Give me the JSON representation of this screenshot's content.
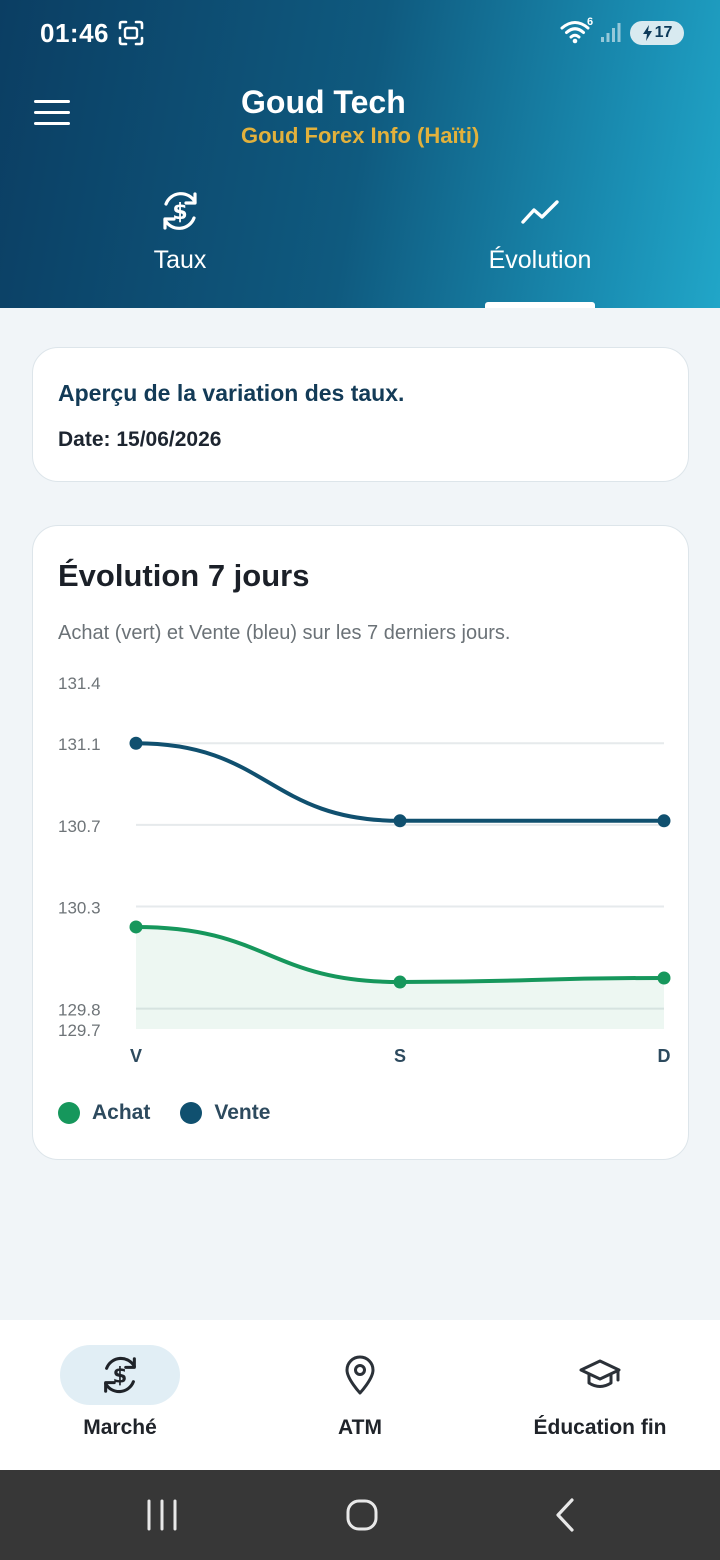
{
  "status_bar": {
    "time": "01:46",
    "wifi_label": "6",
    "battery": "17"
  },
  "header": {
    "title": "Goud Tech",
    "subtitle": "Goud Forex Info (Haïti)"
  },
  "tabs": [
    {
      "label": "Taux",
      "icon": "currency-exchange-icon",
      "active": false
    },
    {
      "label": "Évolution",
      "icon": "trending-icon",
      "active": true
    }
  ],
  "info_card": {
    "title": "Aperçu de la variation des taux.",
    "date": "Date: 15/06/2026"
  },
  "chart_card": {
    "title": "Évolution 7 jours",
    "subtitle": "Achat (vert) et Vente (bleu) sur les 7 derniers jours."
  },
  "chart_data": {
    "type": "line",
    "categories": [
      "V",
      "S",
      "D"
    ],
    "series": [
      {
        "name": "Achat",
        "color": "#16975c",
        "values": [
          130.2,
          129.93,
          129.95
        ]
      },
      {
        "name": "Vente",
        "color": "#10506f",
        "values": [
          131.1,
          130.72,
          130.72
        ]
      }
    ],
    "y_ticks": [
      "131.4",
      "131.1",
      "130.7",
      "130.3",
      "129.8",
      "129.7"
    ],
    "ylim": [
      129.7,
      131.4
    ],
    "grid": true,
    "legend_position": "bottom-left"
  },
  "legend": [
    {
      "label": "Achat",
      "color": "#16975c"
    },
    {
      "label": "Vente",
      "color": "#10506f"
    }
  ],
  "bottom_nav": [
    {
      "label": "Marché",
      "icon": "currency-exchange-icon",
      "active": true
    },
    {
      "label": "ATM",
      "icon": "map-pin-icon",
      "active": false
    },
    {
      "label": "Éducation fin",
      "icon": "graduation-cap-icon",
      "active": false
    }
  ]
}
